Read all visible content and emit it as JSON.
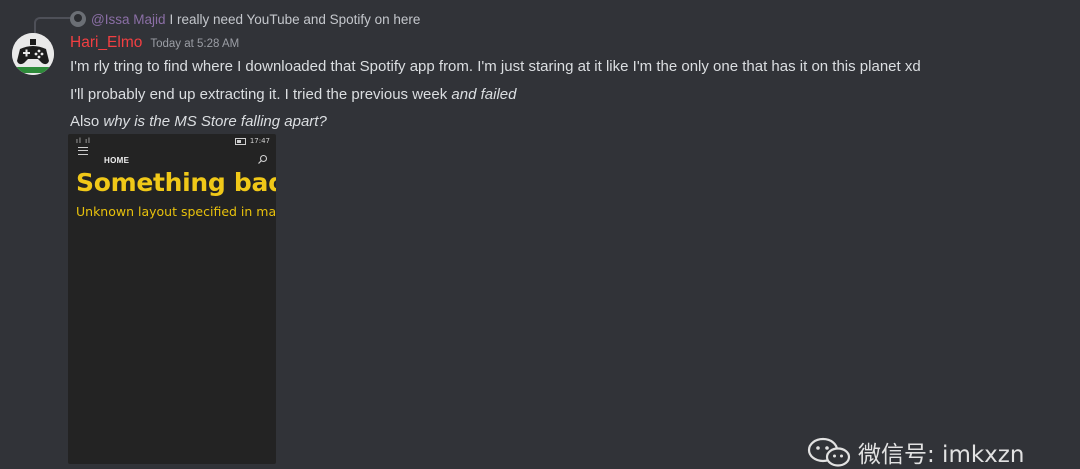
{
  "reply": {
    "mention": "@Issa Majid",
    "text": "I really need YouTube and Spotify on here"
  },
  "message": {
    "username": "Hari_Elmo",
    "timestamp": "Today at 5:28 AM",
    "line1": "I'm rly tring to find where I downloaded that Spotify app from. I'm just staring at it like I'm the only one that has it on this planet xd",
    "line2_plain": "I'll probably end up extracting it. I tried the previous week ",
    "line2_italic": "and failed",
    "line3_plain": "Also ",
    "line3_italic": "why is the MS Store falling apart?"
  },
  "attachment": {
    "status_time": "17:47",
    "nav_label": "HOME",
    "error_title": "Something bad",
    "error_subtitle": "Unknown layout specified in ma"
  },
  "watermark": {
    "text": "微信号: imkxzn"
  },
  "colors": {
    "background": "#313338",
    "username": "#f23f42",
    "error_yellow": "#f0c818"
  }
}
